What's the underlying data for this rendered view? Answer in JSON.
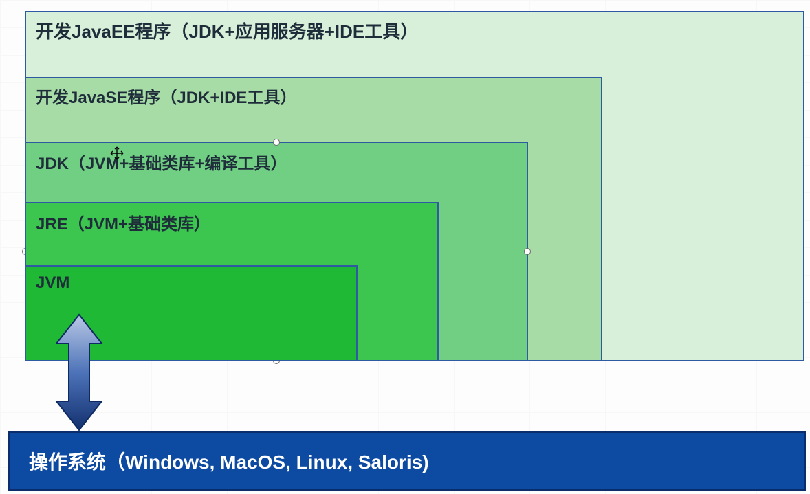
{
  "layers": {
    "javaee": {
      "label": "开发JavaEE程序（JDK+应用服务器+IDE工具）",
      "color": "#d8efd9"
    },
    "javase": {
      "label": "开发JavaSE程序（JDK+IDE工具）",
      "color": "#a7dca7"
    },
    "jdk": {
      "label": "JDK（JVM+基础类库+编译工具）",
      "color": "#70cf83",
      "selected": true
    },
    "jre": {
      "label": "JRE（JVM+基础类库）",
      "color": "#3cc64f"
    },
    "jvm": {
      "label": "JVM",
      "color": "#1fb935"
    }
  },
  "os": {
    "label": "操作系统（Windows, MacOS, Linux, Saloris)"
  },
  "border_color": "#2d5aa0",
  "os_color": "#0d4aa1"
}
